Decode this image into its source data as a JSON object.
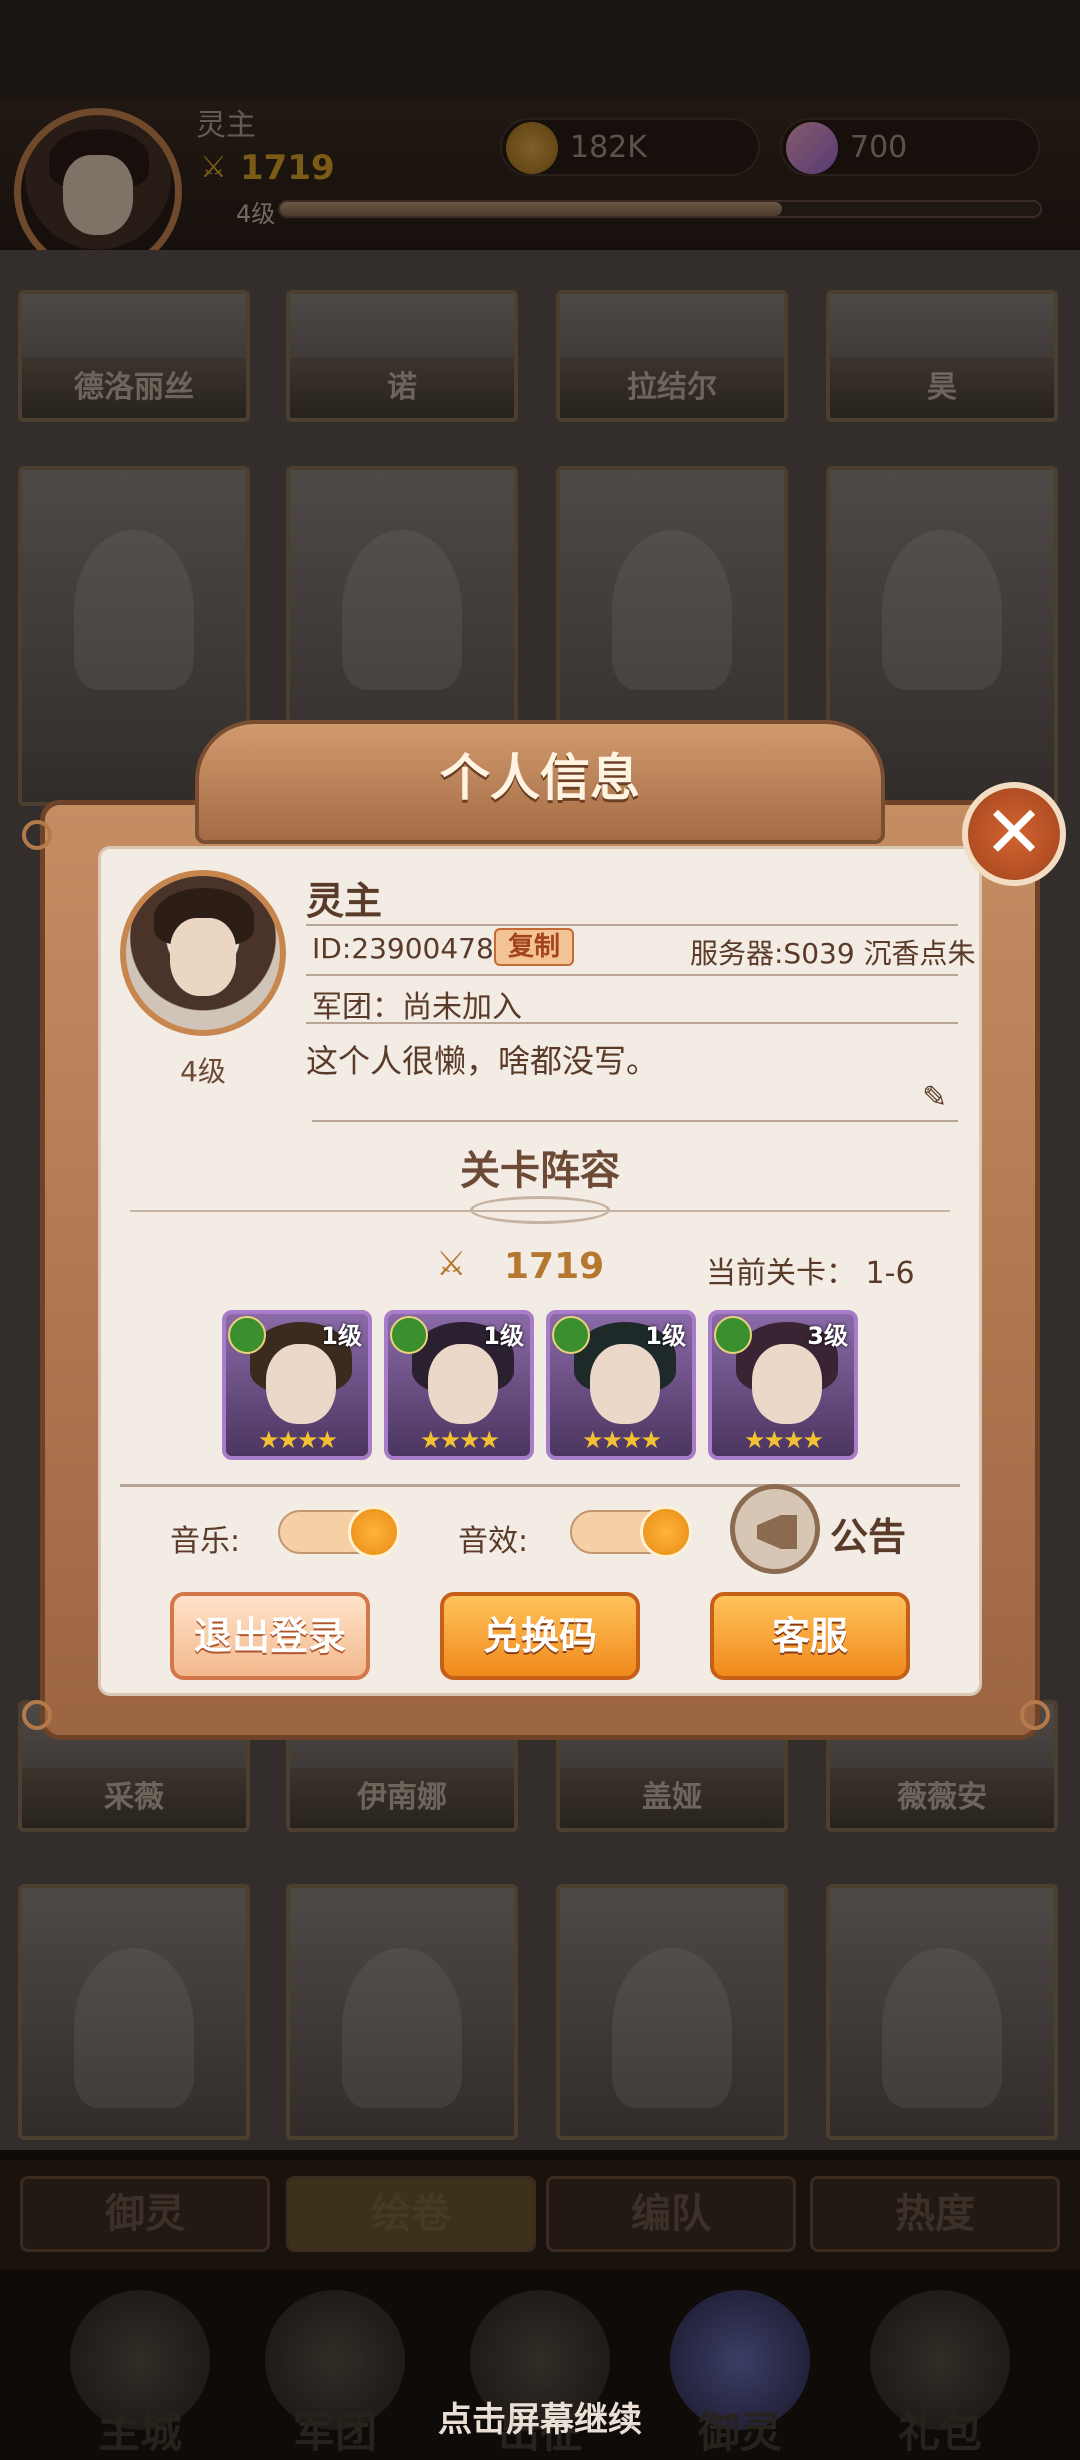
{
  "header": {
    "player_name": "灵主",
    "power": "1719",
    "level": "4级",
    "xp_fraction": 0.66,
    "coins": "182K",
    "gems": "700"
  },
  "collection_top": [
    "德洛丽丝",
    "诺",
    "拉结尔",
    "昊"
  ],
  "collection_mid": [
    "采薇",
    "伊南娜",
    "盖娅",
    "薇薇安"
  ],
  "subtabs": [
    "御灵",
    "绘卷",
    "编队",
    "热度"
  ],
  "bottom_nav": [
    "主城",
    "军团",
    "出征",
    "御灵",
    "礼包"
  ],
  "continue_hint": "点击屏幕继续",
  "dialog": {
    "title": "个人信息",
    "name": "灵主",
    "id_text": "ID:23900478",
    "copy_label": "复制",
    "server": "服务器:S039 沉香点朱",
    "army": "军团：尚未加入",
    "bio": "这个人很懒，啥都没写。",
    "avatar_level": "4级",
    "lineup_title": "关卡阵容",
    "power": "1719",
    "stage_label": "当前关卡：",
    "stage_value": "1-6",
    "heroes": [
      {
        "level": "1级",
        "stars": "★★★★"
      },
      {
        "level": "1级",
        "stars": "★★★★"
      },
      {
        "level": "1级",
        "stars": "★★★★"
      },
      {
        "level": "3级",
        "stars": "★★★★"
      }
    ],
    "music_label": "音乐:",
    "sfx_label": "音效:",
    "notice_label": "公告",
    "logout_label": "退出登录",
    "redeem_label": "兑换码",
    "service_label": "客服"
  },
  "colors": {
    "accent": "#f08a1c",
    "panel": "#c58d62",
    "paper": "#f3ece4"
  }
}
